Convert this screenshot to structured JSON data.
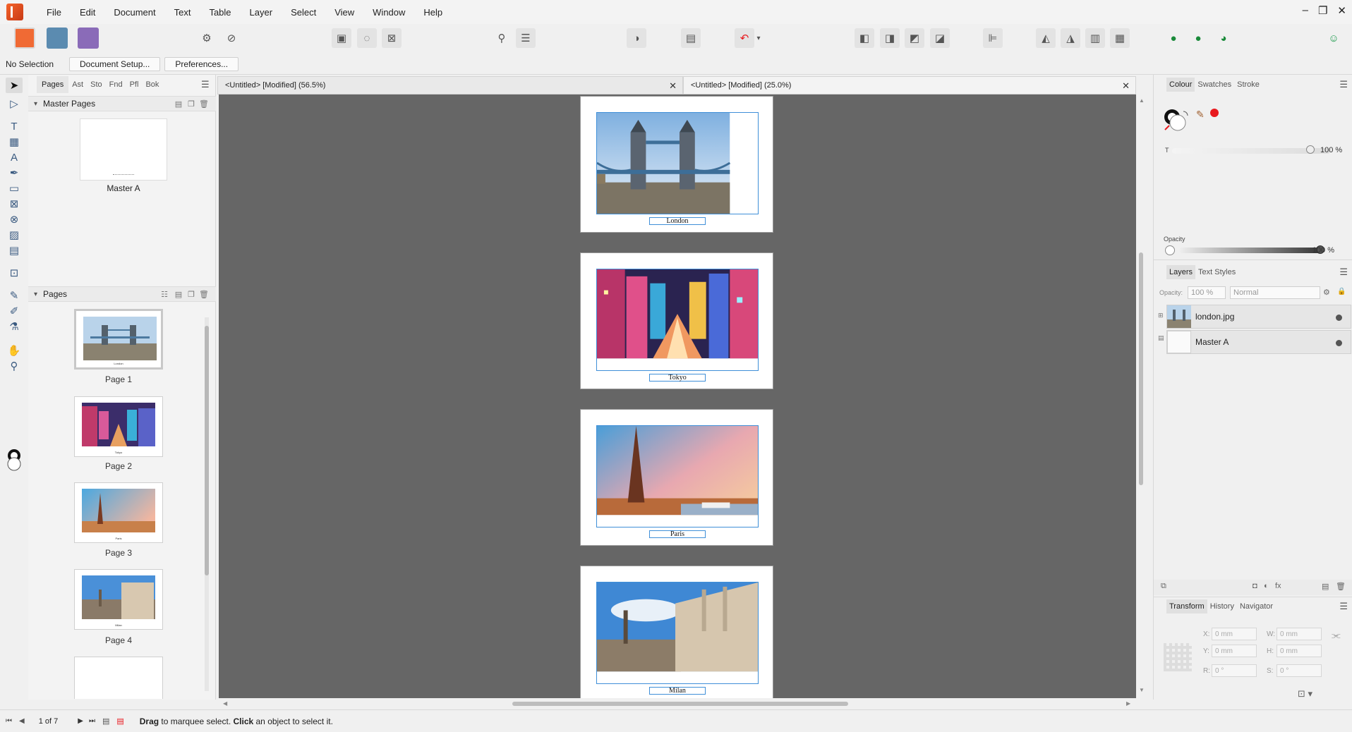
{
  "menubar": {
    "items": [
      "File",
      "Edit",
      "Document",
      "Text",
      "Table",
      "Layer",
      "Select",
      "View",
      "Window",
      "Help"
    ],
    "window_controls": [
      "–",
      "❐",
      "✕"
    ]
  },
  "context": {
    "selection": "No Selection",
    "document_setup": "Document Setup...",
    "preferences": "Preferences..."
  },
  "left_panel": {
    "tabs": [
      "Pages",
      "Ast",
      "Sto",
      "Fnd",
      "Pfl",
      "Bok"
    ],
    "master_section": "Master Pages",
    "master_label": "Master A",
    "pages_section": "Pages",
    "pages": [
      {
        "label": "Page 1",
        "caption": "London"
      },
      {
        "label": "Page 2",
        "caption": "Tokyo"
      },
      {
        "label": "Page 3",
        "caption": "Paris"
      },
      {
        "label": "Page 4",
        "caption": "Milan"
      }
    ]
  },
  "doc_tabs": [
    {
      "title": "<Untitled> [Modified] (56.5%)"
    },
    {
      "title": "<Untitled> [Modified] (25.0%)"
    }
  ],
  "canvas": {
    "spreads": [
      {
        "caption": "London"
      },
      {
        "caption": "Tokyo"
      },
      {
        "caption": "Paris"
      },
      {
        "caption": "Milan"
      }
    ]
  },
  "right_panel": {
    "colour_tabs": [
      "Colour",
      "Swatches",
      "Stroke"
    ],
    "t_label": "T",
    "t_value": "100 %",
    "opacity_label": "Opacity",
    "opacity_value": "100 %",
    "layers_tabs": [
      "Layers",
      "Text Styles"
    ],
    "layers_opacity_label": "Opacity:",
    "layers_opacity_value": "100 %",
    "blend_mode": "Normal",
    "layers": [
      {
        "name": "london.jpg"
      },
      {
        "name": "Master A"
      }
    ],
    "transform_tabs": [
      "Transform",
      "History",
      "Navigator"
    ],
    "transform": {
      "x_label": "X:",
      "x": "0 mm",
      "y_label": "Y:",
      "y": "0 mm",
      "w_label": "W:",
      "w": "0 mm",
      "h_label": "H:",
      "h": "0 mm",
      "r_label": "R:",
      "r": "0 °",
      "s_label": "S:",
      "s": "0 °"
    },
    "colors": {
      "accent_red": "#e8191e",
      "frame_blue": "#3f8fd8"
    }
  },
  "status": {
    "page_counter": "1 of 7",
    "hint_drag": "Drag",
    "hint_mid": " to marquee select. ",
    "hint_click": "Click",
    "hint_end": " an object to select it."
  }
}
